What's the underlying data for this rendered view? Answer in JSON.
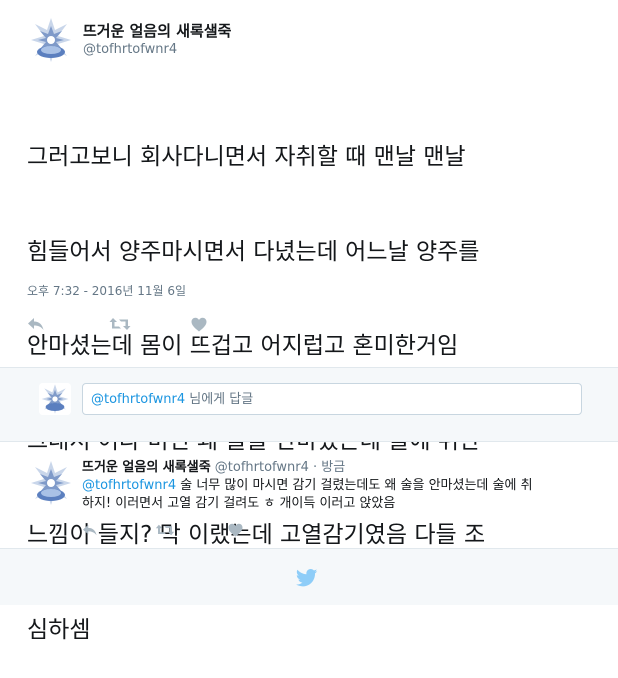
{
  "main_tweet": {
    "name": "뜨거운 얼음의 새록샐죽",
    "handle": "@tofhrtofwnr4",
    "lines": [
      "그러고보니 회사다니면서 자취할 때 맨날 맨날",
      "힘들어서 양주마시면서 다녔는데 어느날 양주를",
      "안마셨는데 몸이 뜨겁고 어지럽고 혼미한거임",
      "그래서 어라 미친 왜 술을 안마셨는데 술에 취한",
      "느낌이 들지? 막 이랬는데 고열감기였음 다들 조",
      "심하셈"
    ],
    "timestamp": "오후 7:32 - 2016년 11월 6일",
    "actions": [
      "reply-icon",
      "retweet-icon",
      "like-icon"
    ]
  },
  "reply_box": {
    "mention": "@tofhrtofwnr4",
    "placeholder": " 님에게 답글"
  },
  "reply_tweet": {
    "name": "뜨거운 얼음의 새록샐죽",
    "handle": "@tofhrtofwnr4",
    "time": "· 방금",
    "mention": "@tofhrtofwnr4",
    "text_line1": " 술 너무 많이 마시면 감기 걸렸는데도 왜 술을 안마셨는데 술에 취",
    "text_line2": "하지! 이러면서 고열 감기 걸려도 ㅎ 개이득 이러고 앉았음",
    "actions": [
      "reply-icon",
      "retweet-icon",
      "like-icon"
    ]
  },
  "footer": {
    "icon": "twitter-bird-icon"
  },
  "colors": {
    "accent": "#1b95e0",
    "muted": "#657786",
    "border": "#e1e8ed",
    "bg_alt": "#f5f8fa"
  }
}
